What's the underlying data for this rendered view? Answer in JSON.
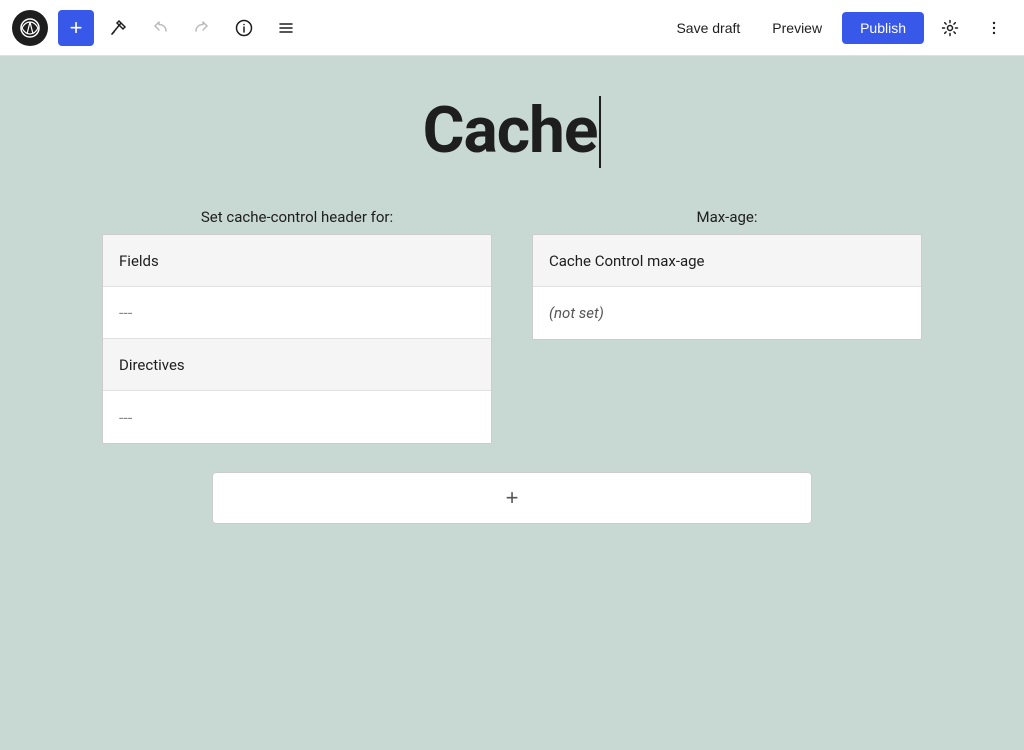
{
  "topbar": {
    "add_label": "+",
    "save_draft_label": "Save draft",
    "preview_label": "Preview",
    "publish_label": "Publish"
  },
  "page": {
    "title": "Cache"
  },
  "left_table": {
    "header": "Set cache-control header for:",
    "rows": [
      {
        "text": "Fields",
        "style": "shaded"
      },
      {
        "text": "---",
        "style": "separator"
      },
      {
        "text": "Directives",
        "style": "shaded"
      },
      {
        "text": "---",
        "style": "separator"
      }
    ]
  },
  "right_table": {
    "header": "Max-age:",
    "rows": [
      {
        "text": "Cache Control max-age",
        "style": "shaded"
      },
      {
        "text": "(not set)",
        "style": "italic"
      }
    ]
  },
  "add_row_label": "+"
}
